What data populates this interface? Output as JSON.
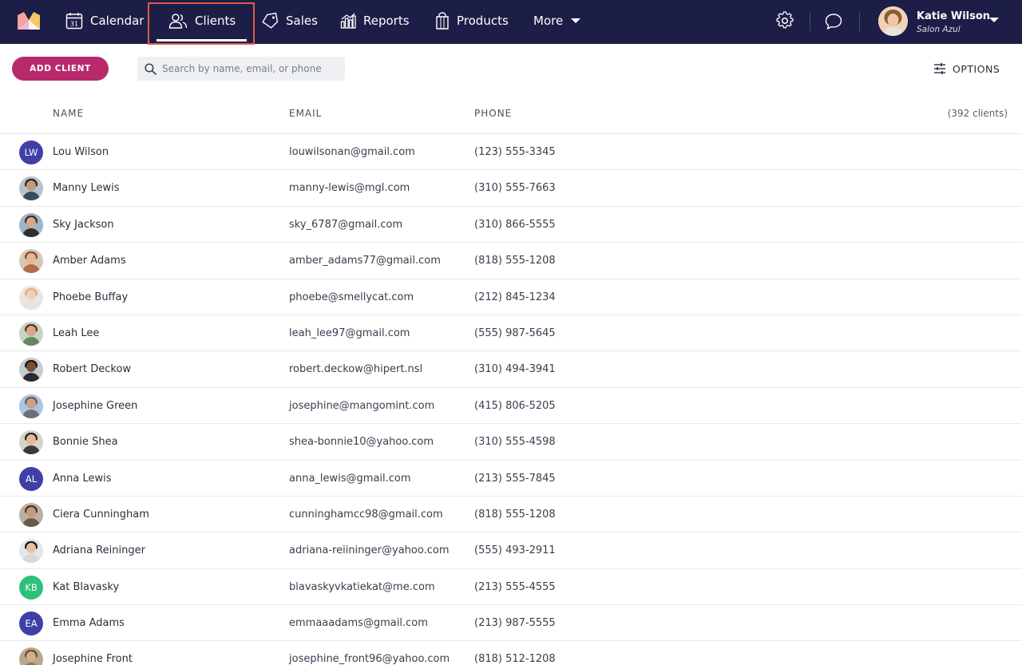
{
  "nav": {
    "items": [
      {
        "label": "Calendar",
        "icon": "calendar-icon",
        "calendar_day": "31"
      },
      {
        "label": "Clients",
        "icon": "clients-icon"
      },
      {
        "label": "Sales",
        "icon": "tag-icon"
      },
      {
        "label": "Reports",
        "icon": "bar-chart-icon"
      },
      {
        "label": "Products",
        "icon": "shopping-bag-icon"
      },
      {
        "label": "More",
        "icon": "chevron-down-icon"
      }
    ],
    "active": "Clients",
    "active_highlight_color": "#e05a47",
    "background": "#1d1e48"
  },
  "user": {
    "name": "Katie Wilson",
    "salon": "Salon Azul"
  },
  "toolbar": {
    "add_client_label": "ADD CLIENT",
    "add_client_color": "#b92a6c",
    "search_placeholder": "Search by name, email, or phone",
    "options_label": "OPTIONS"
  },
  "table": {
    "columns": {
      "name": "NAME",
      "email": "EMAIL",
      "phone": "PHONE"
    },
    "count_label": "(392 clients)",
    "rows": [
      {
        "name": "Lou Wilson",
        "email": "louwilsonan@gmail.com",
        "phone": "(123) 555-3345",
        "initials": "LW",
        "avatar_color": "#3f3fa8",
        "photo": false
      },
      {
        "name": "Manny Lewis",
        "email": "manny-lewis@mgl.com",
        "phone": "(310) 555-7663",
        "photo": true,
        "skin": "#c49a7a",
        "hair": "#2a2420",
        "shirt": "#3b4a5a",
        "bg": "#b7c2cc"
      },
      {
        "name": "Sky Jackson",
        "email": "sky_6787@gmail.com",
        "phone": "(310) 866-5555",
        "photo": true,
        "skin": "#d6a98a",
        "hair": "#3b2a22",
        "shirt": "#2e2e2e",
        "bg": "#9fb4c4"
      },
      {
        "name": "Amber Adams",
        "email": "amber_adams77@gmail.com",
        "phone": "(818) 555-1208",
        "photo": true,
        "skin": "#e3b796",
        "hair": "#8a4a2a",
        "shirt": "#b36a4a",
        "bg": "#d8c6b4"
      },
      {
        "name": "Phoebe Buffay",
        "email": "phoebe@smellycat.com",
        "phone": "(212) 845-1234",
        "photo": true,
        "skin": "#efcfb5",
        "hair": "#d9b27a",
        "shirt": "#e8e3dc",
        "bg": "#e9e5df"
      },
      {
        "name": "Leah Lee",
        "email": "leah_lee97@gmail.com",
        "phone": "(555) 987-5645",
        "photo": true,
        "skin": "#d9a688",
        "hair": "#5a3522",
        "shirt": "#5f8a5a",
        "bg": "#c9d3c2"
      },
      {
        "name": "Robert Deckow",
        "email": "robert.deckow@hipert.nsl",
        "phone": "(310) 494-3941",
        "photo": true,
        "skin": "#7a5038",
        "hair": "#1e1612",
        "shirt": "#2a2a30",
        "bg": "#c7ccd3"
      },
      {
        "name": "Josephine Green",
        "email": "josephine@mangomint.com",
        "phone": "(415) 806-5205",
        "photo": true,
        "skin": "#caa188",
        "hair": "#6a5a52",
        "shirt": "#6b6f78",
        "bg": "#a9c6e2"
      },
      {
        "name": "Bonnie Shea",
        "email": "shea-bonnie10@yahoo.com",
        "phone": "(310) 555-4598",
        "photo": true,
        "skin": "#e2b999",
        "hair": "#2b1e18",
        "shirt": "#3a3a3a",
        "bg": "#d7d2cc"
      },
      {
        "name": "Anna Lewis",
        "email": "anna_lewis@gmail.com",
        "phone": "(213) 555-7845",
        "initials": "AL",
        "avatar_color": "#3f3fa8",
        "photo": false
      },
      {
        "name": "Ciera Cunningham",
        "email": "cunninghamcc98@gmail.com",
        "phone": "(818) 555-1208",
        "photo": true,
        "skin": "#c79a7a",
        "hair": "#4a3326",
        "shirt": "#6a5a4a",
        "bg": "#b9b1a6"
      },
      {
        "name": "Adriana Reininger",
        "email": "adriana-reiininger@yahoo.com",
        "phone": "(555) 493-2911",
        "photo": true,
        "skin": "#e4c1a5",
        "hair": "#1f1a18",
        "shirt": "#d9d9d9",
        "bg": "#e4e6e8"
      },
      {
        "name": "Kat Blavasky",
        "email": "blavaskyvkatiekat@me.com",
        "phone": "(213) 555-4555",
        "initials": "KB",
        "avatar_color": "#2fbf7a",
        "photo": false
      },
      {
        "name": "Emma Adams",
        "email": "emmaaadams@gmail.com",
        "phone": "(213) 987-5555",
        "initials": "EA",
        "avatar_color": "#3f3fa8",
        "photo": false
      },
      {
        "name": "Josephine Front",
        "email": "josephine_front96@yahoo.com",
        "phone": "(818) 512-1208",
        "photo": true,
        "skin": "#d8ad8c",
        "hair": "#6b4a2a",
        "shirt": "#8a7a5a",
        "bg": "#b7a98e"
      }
    ]
  }
}
